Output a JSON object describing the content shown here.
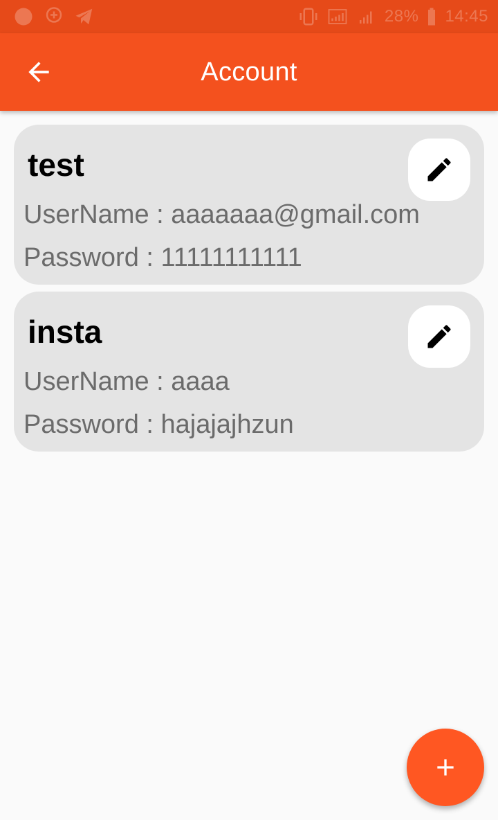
{
  "status_bar": {
    "battery": "28%",
    "time": "14:45"
  },
  "app_bar": {
    "title": "Account",
    "back_icon": "arrow-back-icon"
  },
  "accounts": [
    {
      "title": "test",
      "username_line": "UserName : aaaaaaa@gmail.com",
      "password_line": "Password : 11111111111",
      "edit_icon": "pencil-icon"
    },
    {
      "title": "insta",
      "username_line": "UserName : aaaa",
      "password_line": "Password : hajajajhzun",
      "edit_icon": "pencil-icon"
    }
  ],
  "fab": {
    "icon": "plus-icon"
  },
  "colors": {
    "status_bar": "#e64a19",
    "app_bar": "#f4511e",
    "fab": "#ff5722",
    "card": "#e4e4e4"
  }
}
